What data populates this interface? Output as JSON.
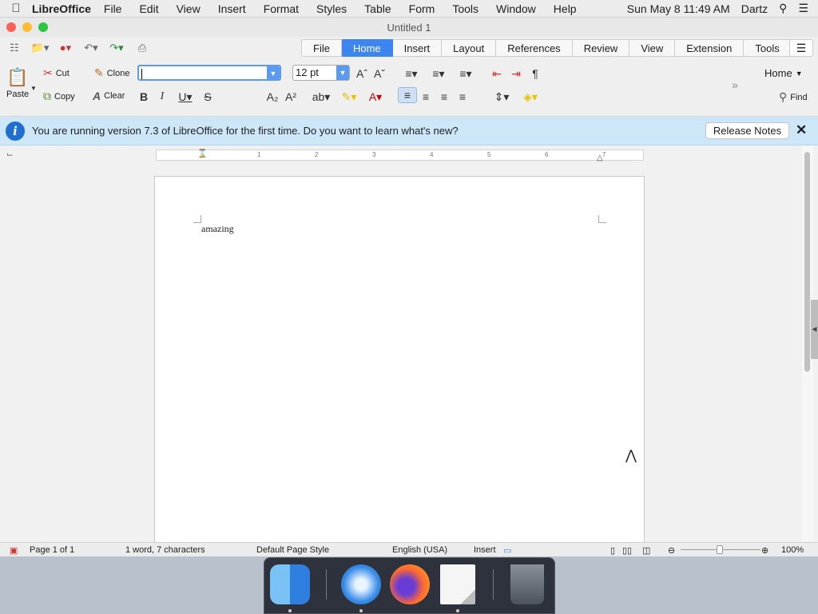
{
  "menubar": {
    "app_name": "LibreOffice",
    "items": [
      "File",
      "Edit",
      "View",
      "Insert",
      "Format",
      "Styles",
      "Table",
      "Form",
      "Tools",
      "Window",
      "Help"
    ],
    "clock": "Sun May 8  11:49 AM",
    "user": "Dartz"
  },
  "window": {
    "title": "Untitled 1"
  },
  "tabs": {
    "items": [
      "File",
      "Home",
      "Insert",
      "Layout",
      "References",
      "Review",
      "View",
      "Extension",
      "Tools"
    ],
    "active": "Home"
  },
  "toolbar": {
    "paste_label": "Paste",
    "cut_label": "Cut",
    "copy_label": "Copy",
    "clone_label": "Clone",
    "clear_label": "Clear",
    "font_name_value": "",
    "font_size_value": "12 pt",
    "home_dropdown_label": "Home",
    "find_label": "Find"
  },
  "infobar": {
    "message": "You are running version 7.3 of LibreOffice for the first time. Do you want to learn what's new?",
    "button_label": "Release Notes"
  },
  "document": {
    "text": "amazing"
  },
  "ruler": {
    "numbers": [
      "1",
      "2",
      "3",
      "4",
      "5",
      "6",
      "7"
    ]
  },
  "statusbar": {
    "page": "Page 1 of 1",
    "word_count": "1 word, 7 characters",
    "page_style": "Default Page Style",
    "language": "English (USA)",
    "insert_mode": "Insert",
    "zoom": "100%"
  },
  "colors": {
    "accent": "#3d86f0",
    "infobar_bg": "#cde7f8",
    "info_icon": "#1e6fd0"
  },
  "dock": {
    "apps": [
      "finder-icon",
      "safari-icon",
      "firefox-icon",
      "libreoffice-icon",
      "trash-icon"
    ]
  }
}
